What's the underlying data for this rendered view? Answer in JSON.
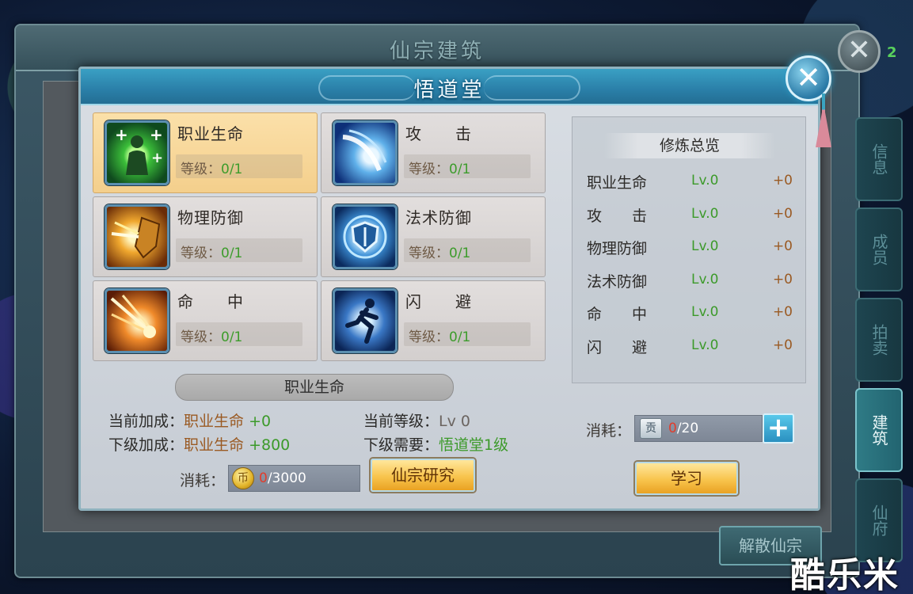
{
  "outer_window": {
    "title": "仙宗建筑",
    "close_label": "✕",
    "side_number": "2",
    "tabs": [
      "信息",
      "成员",
      "拍卖",
      "建筑",
      "仙府"
    ],
    "active_tab": "建筑",
    "dissolve_button": "解散仙宗"
  },
  "dialog": {
    "title": "悟道堂",
    "close_label": "✕"
  },
  "skills": [
    {
      "name": "职业生命",
      "level_label": "等级：",
      "level_value": "0/1",
      "icon": "heal-figure-icon",
      "selected": true
    },
    {
      "name": "攻　　击",
      "level_label": "等级：",
      "level_value": "0/1",
      "icon": "sword-slash-icon",
      "selected": false
    },
    {
      "name": "物理防御",
      "level_label": "等级：",
      "level_value": "0/1",
      "icon": "shield-strike-icon",
      "selected": false
    },
    {
      "name": "法术防御",
      "level_label": "等级：",
      "level_value": "0/1",
      "icon": "magic-shield-icon",
      "selected": false
    },
    {
      "name": "命　　中",
      "level_label": "等级：",
      "level_value": "0/1",
      "icon": "arrow-burst-icon",
      "selected": false
    },
    {
      "name": "闪　　避",
      "level_label": "等级：",
      "level_value": "0/1",
      "icon": "running-figure-icon",
      "selected": false
    }
  ],
  "detail": {
    "title": "职业生命",
    "current_bonus_label": "当前加成：",
    "current_bonus_name": "职业生命",
    "current_bonus_value": "+0",
    "next_bonus_label": "下级加成：",
    "next_bonus_name": "职业生命",
    "next_bonus_value": "+800",
    "current_level_label": "当前等级：",
    "current_level_value": "Lv 0",
    "next_require_label": "下级需要：",
    "next_require_value": "悟道堂1级",
    "cost_label": "消耗：",
    "cost_icon_text": "币",
    "cost_current": "0",
    "cost_total": "/3000",
    "research_button": "仙宗研究"
  },
  "overview": {
    "title": "修炼总览",
    "rows": [
      {
        "name": "职业生命",
        "level": "Lv.0",
        "bonus": "+0"
      },
      {
        "name": "攻　　击",
        "level": "Lv.0",
        "bonus": "+0"
      },
      {
        "name": "物理防御",
        "level": "Lv.0",
        "bonus": "+0"
      },
      {
        "name": "法术防御",
        "level": "Lv.0",
        "bonus": "+0"
      },
      {
        "name": "命　　中",
        "level": "Lv.0",
        "bonus": "+0"
      },
      {
        "name": "闪　　避",
        "level": "Lv.0",
        "bonus": "+0"
      }
    ],
    "cost_label": "消耗：",
    "cost_icon_text": "贡",
    "cost_current": "0",
    "cost_total": "/20",
    "plus_label": "+",
    "learn_button": "学习"
  },
  "watermark": "酷乐米"
}
